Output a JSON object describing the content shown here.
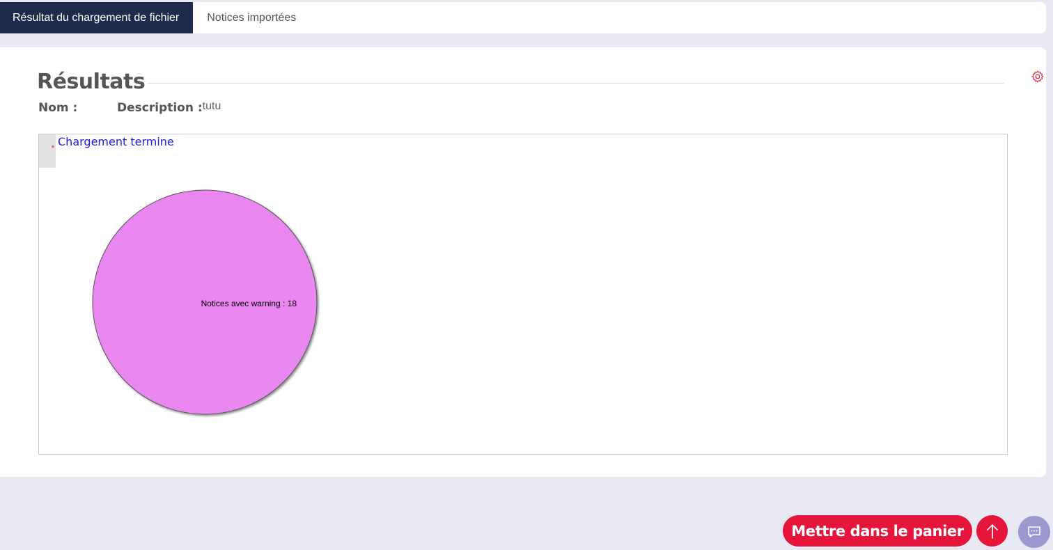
{
  "tabs": [
    {
      "label": "Résultat du chargement de fichier",
      "active": true
    },
    {
      "label": "Notices importées",
      "active": false
    }
  ],
  "results": {
    "title": "Résultats",
    "nom_label": "Nom :",
    "nom_value": "",
    "description_label": "Description :",
    "description_value": "tutu"
  },
  "status": {
    "marker": "*",
    "text": "Chargement termine"
  },
  "chart_data": {
    "type": "pie",
    "slices": [
      {
        "label": "Notices avec warning",
        "value": 18,
        "color": "#e986ef"
      }
    ],
    "labels_shown": [
      "Notices avec warning : 18"
    ]
  },
  "actions": {
    "cart_label": "Mettre dans le panier",
    "scroll_top_icon": "arrow-up-icon",
    "chat_icon": "chat-bubble-icon"
  },
  "colors": {
    "accent": "#e5153b",
    "tab_active_bg": "#1e2b4a",
    "status_text": "#1a1af0",
    "chat_bg": "#9a98cf"
  }
}
